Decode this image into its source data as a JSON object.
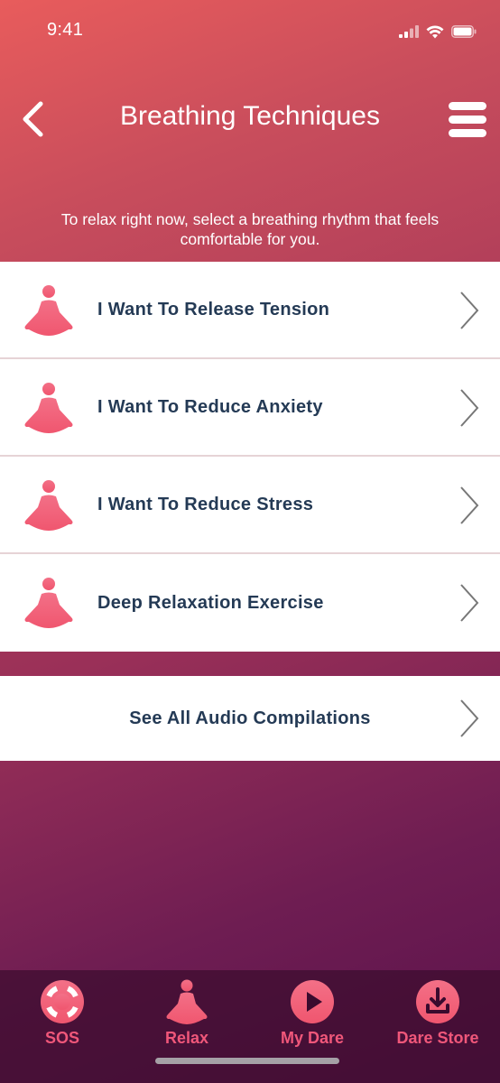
{
  "status_bar": {
    "time": "9:41"
  },
  "header": {
    "title": "Breathing Techniques"
  },
  "subtitle": "To relax right now, select a breathing rhythm that feels comfortable for you.",
  "list": {
    "items": [
      {
        "label": "I Want To Release Tension",
        "icon": "meditation-icon"
      },
      {
        "label": "I Want To Reduce Anxiety",
        "icon": "meditation-icon"
      },
      {
        "label": "I Want To Reduce Stress",
        "icon": "meditation-icon"
      },
      {
        "label": "Deep Relaxation Exercise",
        "icon": "meditation-icon"
      }
    ]
  },
  "audio": {
    "label": "See All Audio Compilations"
  },
  "tabs": [
    {
      "label": "SOS",
      "icon": "lifebuoy-icon"
    },
    {
      "label": "Relax",
      "icon": "meditation-icon"
    },
    {
      "label": "My Dare",
      "icon": "play-icon"
    },
    {
      "label": "Dare Store",
      "icon": "download-icon"
    }
  ],
  "colors": {
    "accent": "#f0577a",
    "text_dark": "#243a55",
    "header_gradient_top": "#e85c5c",
    "background_bottom": "#5a124b"
  }
}
